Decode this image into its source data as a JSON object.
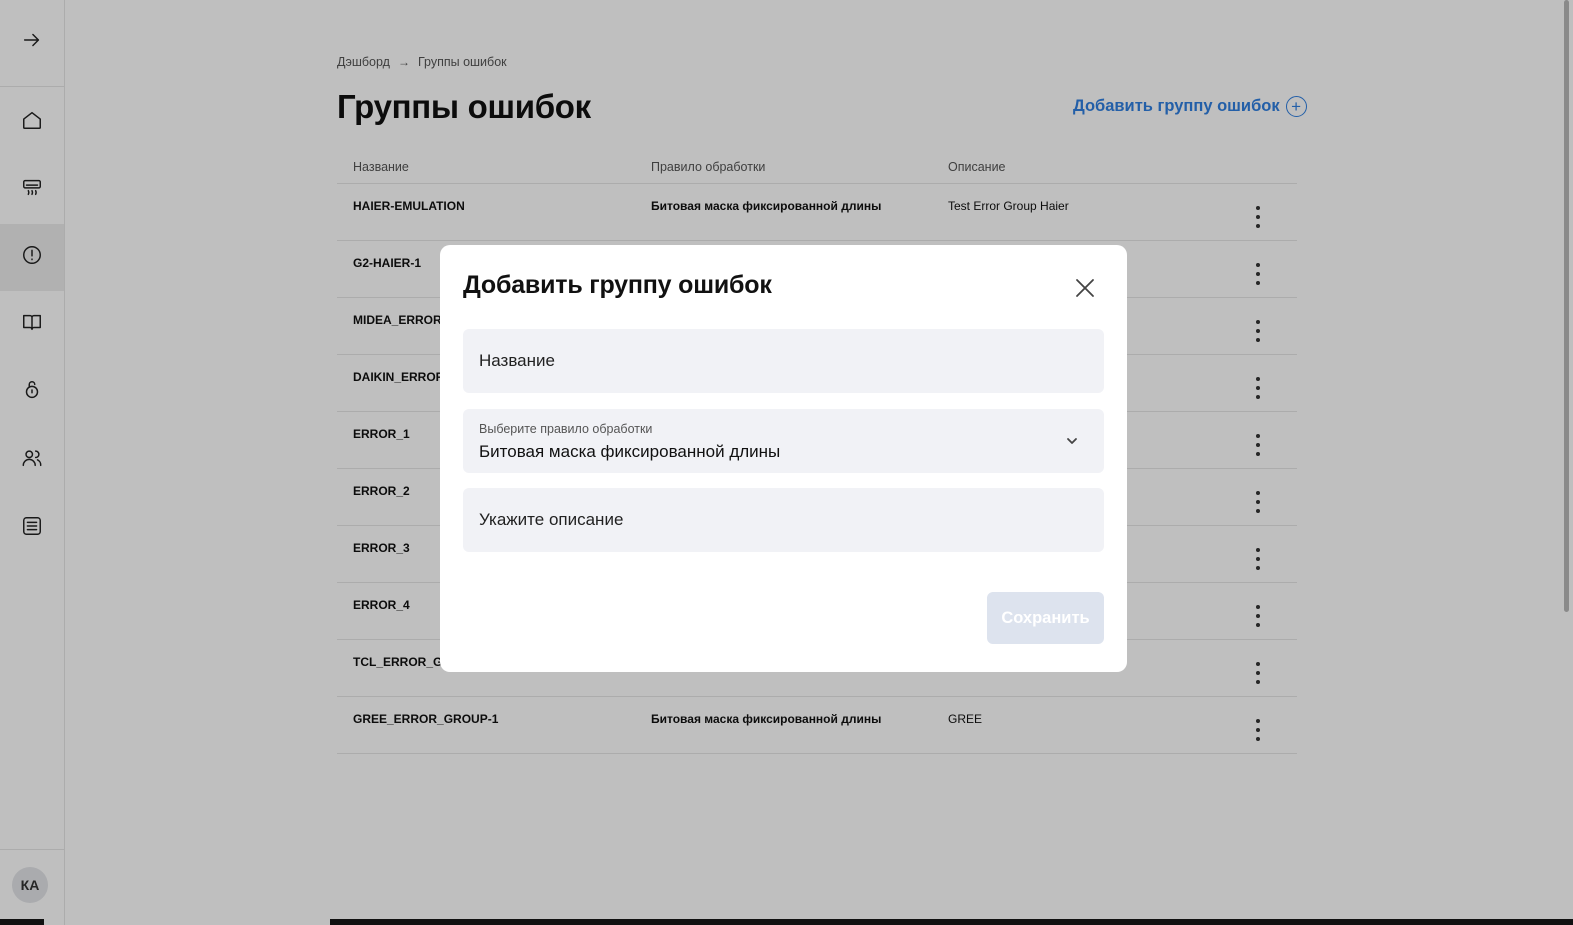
{
  "sidebar": {
    "items": [
      {
        "name": "expand",
        "icon": "arrow-right-icon"
      },
      {
        "name": "home",
        "icon": "home-icon"
      },
      {
        "name": "devices",
        "icon": "air-conditioner-icon"
      },
      {
        "name": "errors",
        "icon": "alert-circle-icon",
        "active": true
      },
      {
        "name": "docs",
        "icon": "book-icon"
      },
      {
        "name": "security",
        "icon": "lock-icon"
      },
      {
        "name": "users",
        "icon": "users-icon"
      },
      {
        "name": "logs",
        "icon": "list-icon"
      }
    ],
    "avatar": "КА"
  },
  "breadcrumb": {
    "root": "Дэшборд",
    "current": "Группы ошибок"
  },
  "page": {
    "title": "Группы ошибок",
    "add_label": "Добавить группу ошибок"
  },
  "table": {
    "headers": [
      "Название",
      "Правило обработки",
      "Описание"
    ],
    "rows": [
      {
        "name": "HAIER-EMULATION",
        "rule": "Битовая маска фиксированной длины",
        "description": "Test Error Group Haier"
      },
      {
        "name": "G2-HAIER-1",
        "rule": "",
        "description": ""
      },
      {
        "name": "MIDEA_ERROR_",
        "rule": "",
        "description": ""
      },
      {
        "name": "DAIKIN_ERROR",
        "rule": "",
        "description": ""
      },
      {
        "name": "ERROR_1",
        "rule": "",
        "description": ""
      },
      {
        "name": "ERROR_2",
        "rule": "",
        "description": ""
      },
      {
        "name": "ERROR_3",
        "rule": "",
        "description": ""
      },
      {
        "name": "ERROR_4",
        "rule": "",
        "description": ""
      },
      {
        "name": "TCL_ERROR_GI",
        "rule": "",
        "description": ""
      },
      {
        "name": "GREE_ERROR_GROUP-1",
        "rule": "Битовая маска фиксированной длины",
        "description": "GREE"
      }
    ]
  },
  "modal": {
    "title": "Добавить группу ошибок",
    "name_placeholder": "Название",
    "name_value": "",
    "rule_label": "Выберите правило обработки",
    "rule_value": "Битовая маска фиксированной длины",
    "description_placeholder": "Укажите описание",
    "description_value": "",
    "save_label": "Сохранить"
  },
  "colors": {
    "accent": "#2f7fe0",
    "overlay": "rgba(0,0,0,0.25)",
    "field_bg": "#f1f2f6",
    "save_disabled": "#dde3ee"
  }
}
